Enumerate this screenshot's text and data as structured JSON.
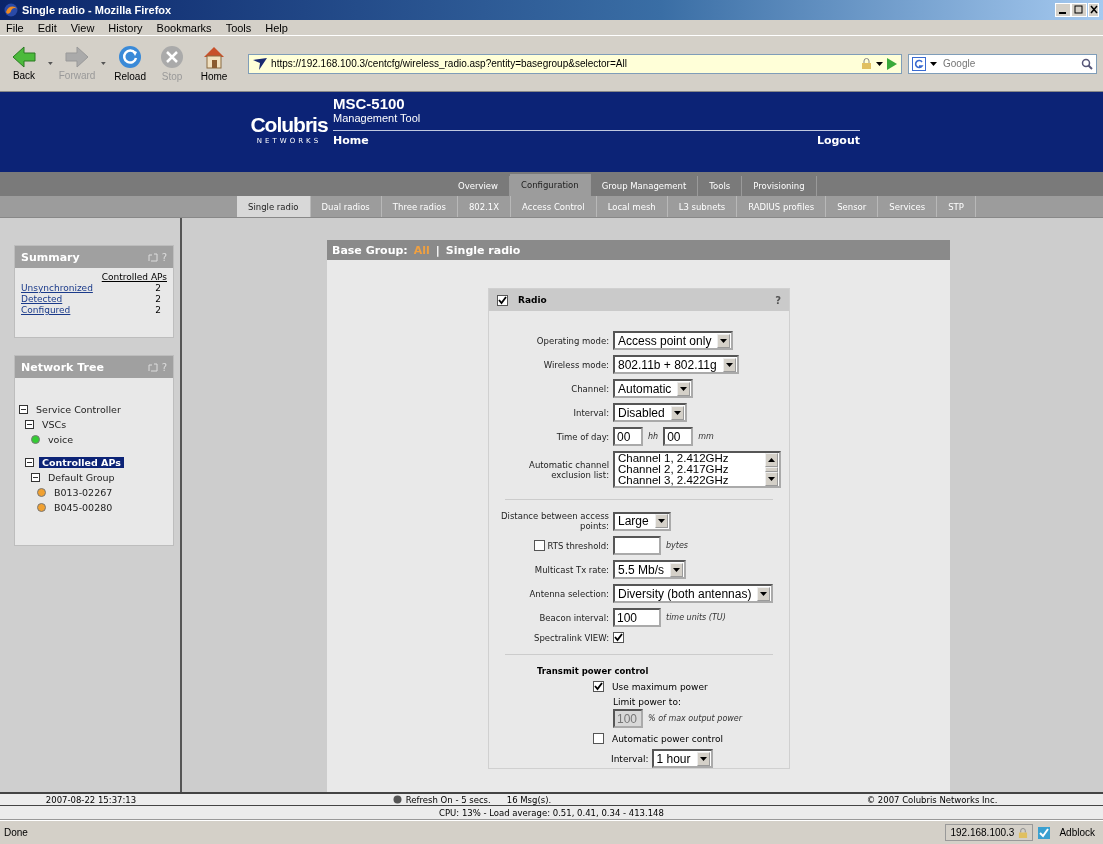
{
  "window": {
    "title": "Single radio - Mozilla Firefox"
  },
  "menu": [
    "File",
    "Edit",
    "View",
    "History",
    "Bookmarks",
    "Tools",
    "Help"
  ],
  "toolbar": [
    {
      "kind": "back",
      "label": "Back",
      "disabled": false
    },
    {
      "kind": "forward",
      "label": "Forward",
      "disabled": true
    },
    {
      "kind": "reload",
      "label": "Reload",
      "disabled": false
    },
    {
      "kind": "stop",
      "label": "Stop",
      "disabled": true
    },
    {
      "kind": "home",
      "label": "Home",
      "disabled": false
    }
  ],
  "address": {
    "value": "https://192.168.100.3/centcfg/wireless_radio.asp?entity=basegroup&selector=All"
  },
  "search": {
    "placeholder": "Google"
  },
  "header": {
    "brand": "Colubris",
    "brand_sub": "NETWORKS",
    "product": "MSC-5100",
    "subtitle": "Management Tool",
    "home": "Home",
    "logout": "Logout"
  },
  "main_tabs": [
    {
      "label": "Overview",
      "selected": false
    },
    {
      "label": "Configuration",
      "selected": true
    },
    {
      "label": "Group Management",
      "selected": false
    },
    {
      "label": "Tools",
      "selected": false
    },
    {
      "label": "Provisioning",
      "selected": false
    }
  ],
  "sub_tabs": [
    {
      "label": "Single radio",
      "selected": true
    },
    {
      "label": "Dual radios",
      "selected": false
    },
    {
      "label": "Three radios",
      "selected": false
    },
    {
      "label": "802.1X",
      "selected": false
    },
    {
      "label": "Access Control",
      "selected": false
    },
    {
      "label": "Local mesh",
      "selected": false
    },
    {
      "label": "L3 subnets",
      "selected": false
    },
    {
      "label": "RADIUS profiles",
      "selected": false
    },
    {
      "label": "Sensor",
      "selected": false
    },
    {
      "label": "Services",
      "selected": false
    },
    {
      "label": "STP",
      "selected": false
    }
  ],
  "summary": {
    "title": "Summary",
    "help": "?",
    "column": "Controlled APs",
    "rows": [
      {
        "label": "Unsynchronized",
        "count": "2"
      },
      {
        "label": "Detected",
        "count": "2"
      },
      {
        "label": "Configured",
        "count": "2"
      }
    ]
  },
  "network_tree": {
    "title": "Network Tree",
    "help": "?",
    "items": [
      {
        "kind": "group",
        "label": "Service Controller",
        "expanded": true,
        "selected": false,
        "children": [
          {
            "kind": "group",
            "label": "VSCs",
            "expanded": true,
            "selected": false,
            "children": [
              {
                "kind": "node",
                "label": "voice",
                "color": "#33cc33",
                "selected": false
              }
            ]
          },
          {
            "kind": "group",
            "label": "Controlled APs",
            "expanded": true,
            "selected": true,
            "children": [
              {
                "kind": "group",
                "label": "Default Group",
                "expanded": true,
                "selected": false,
                "children": [
                  {
                    "kind": "node",
                    "label": "B013-02267",
                    "color": "#f0a030",
                    "selected": false
                  },
                  {
                    "kind": "node",
                    "label": "B045-00280",
                    "color": "#f0a030",
                    "selected": false
                  }
                ]
              }
            ]
          }
        ]
      }
    ]
  },
  "breadcrumb": {
    "prefix": "Base Group:",
    "group": "All",
    "separator": "|",
    "page": "Single radio"
  },
  "radio_panel": {
    "title": "Radio",
    "checked": true,
    "help": "?",
    "fields": [
      {
        "kind": "select",
        "label": "Operating mode:",
        "value": "Access point only"
      },
      {
        "kind": "select",
        "label": "Wireless mode:",
        "value": "802.11b + 802.11g"
      },
      {
        "kind": "select",
        "label": "Channel:",
        "value": "Automatic"
      },
      {
        "kind": "select",
        "label": "Interval:",
        "value": "Disabled"
      },
      {
        "kind": "time",
        "label": "Time of day:",
        "hours": "00",
        "hours_unit": "hh",
        "minutes": "00",
        "minutes_unit": "mm"
      },
      {
        "kind": "listbox",
        "label": "Automatic channel exclusion list:",
        "options": [
          "Channel 1, 2.412GHz",
          "Channel 2, 2.417GHz",
          "Channel 3, 2.422GHz"
        ]
      },
      {
        "kind": "divider"
      },
      {
        "kind": "select",
        "label": "Distance between access points:",
        "value": "Large"
      },
      {
        "kind": "check_text",
        "label": "RTS threshold:",
        "checked": false,
        "unit": "bytes"
      },
      {
        "kind": "select",
        "label": "Multicast Tx rate:",
        "value": "5.5 Mb/s"
      },
      {
        "kind": "select",
        "label": "Antenna selection:",
        "value": "Diversity (both antennas)"
      },
      {
        "kind": "text",
        "label": "Beacon interval:",
        "value": "100",
        "unit": "time units (TU)"
      },
      {
        "kind": "checkbox",
        "label": "Spectralink VIEW:",
        "checked": true
      },
      {
        "kind": "divider"
      },
      {
        "kind": "heading",
        "label": "Transmit power control"
      },
      {
        "kind": "option",
        "label": "Use maximum power",
        "checked": true
      },
      {
        "kind": "limit",
        "label": "Limit power to:",
        "value": "100",
        "disabled": true,
        "unit": "% of max output power"
      },
      {
        "kind": "option",
        "label": "Automatic power control",
        "checked": false
      },
      {
        "kind": "sub_select",
        "label": "Interval:",
        "value": "1 hour"
      }
    ]
  },
  "footer": {
    "timestamp": "2007-08-22 15:37:13",
    "refresh": "Refresh On - 5 secs.",
    "messages": "16 Msg(s).",
    "copyright": "© 2007 Colubris Networks Inc.",
    "cpu": "CPU: 13% - Load average: 0.51, 0.41, 0.34 - 413.148"
  },
  "status_bar": {
    "text": "Done",
    "host": "192.168.100.3",
    "addon": "Adblock"
  }
}
